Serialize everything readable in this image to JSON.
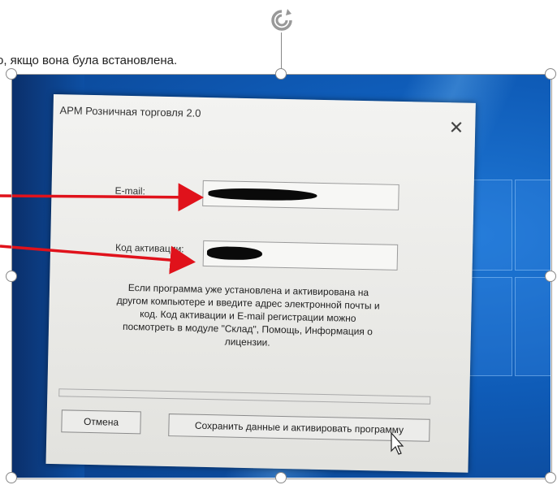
{
  "document": {
    "text_line": "о, якщо вона була встановлена."
  },
  "dialog": {
    "title": "АРМ Розничная торговля 2.0",
    "close_symbol": "✕",
    "email_label": "E-mail:",
    "activation_label": "Код активации:",
    "info_text": "Если программа уже установлена и активирована на другом компьютере и введите адрес электронной почты и код. Код активации и E-mail регистрации можно посмотреть в модуле \"Склад\", Помощь, Информация о лицензии.",
    "cancel_label": "Отмена",
    "save_activate_label": "Сохранить данные и активировать программу"
  },
  "colors": {
    "arrow": "#e0121b",
    "desktop_blue": "#0f5cb8",
    "handle_border": "#888888"
  },
  "icons": {
    "rotate": "rotate-handle-icon",
    "cursor": "mouse-pointer-icon"
  }
}
